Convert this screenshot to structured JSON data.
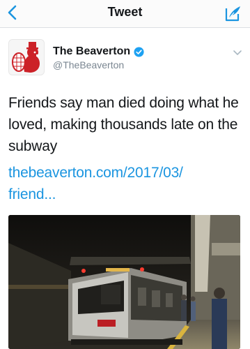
{
  "nav": {
    "title": "Tweet"
  },
  "author": {
    "name": "The Beaverton",
    "handle": "@TheBeaverton"
  },
  "tweet": {
    "text": "Friends say man died doing what he loved, making thousands late on the subway",
    "link_line1": "thebeaverton.com/2017/03/",
    "link_line2": "friend..."
  },
  "colors": {
    "accent": "#1b95e0",
    "text": "#14171a",
    "muted": "#7a8691"
  },
  "icons": {
    "back": "chevron-left-icon",
    "compose": "compose-quill-icon",
    "verified": "verified-badge-icon",
    "caret": "chevron-down-icon"
  }
}
